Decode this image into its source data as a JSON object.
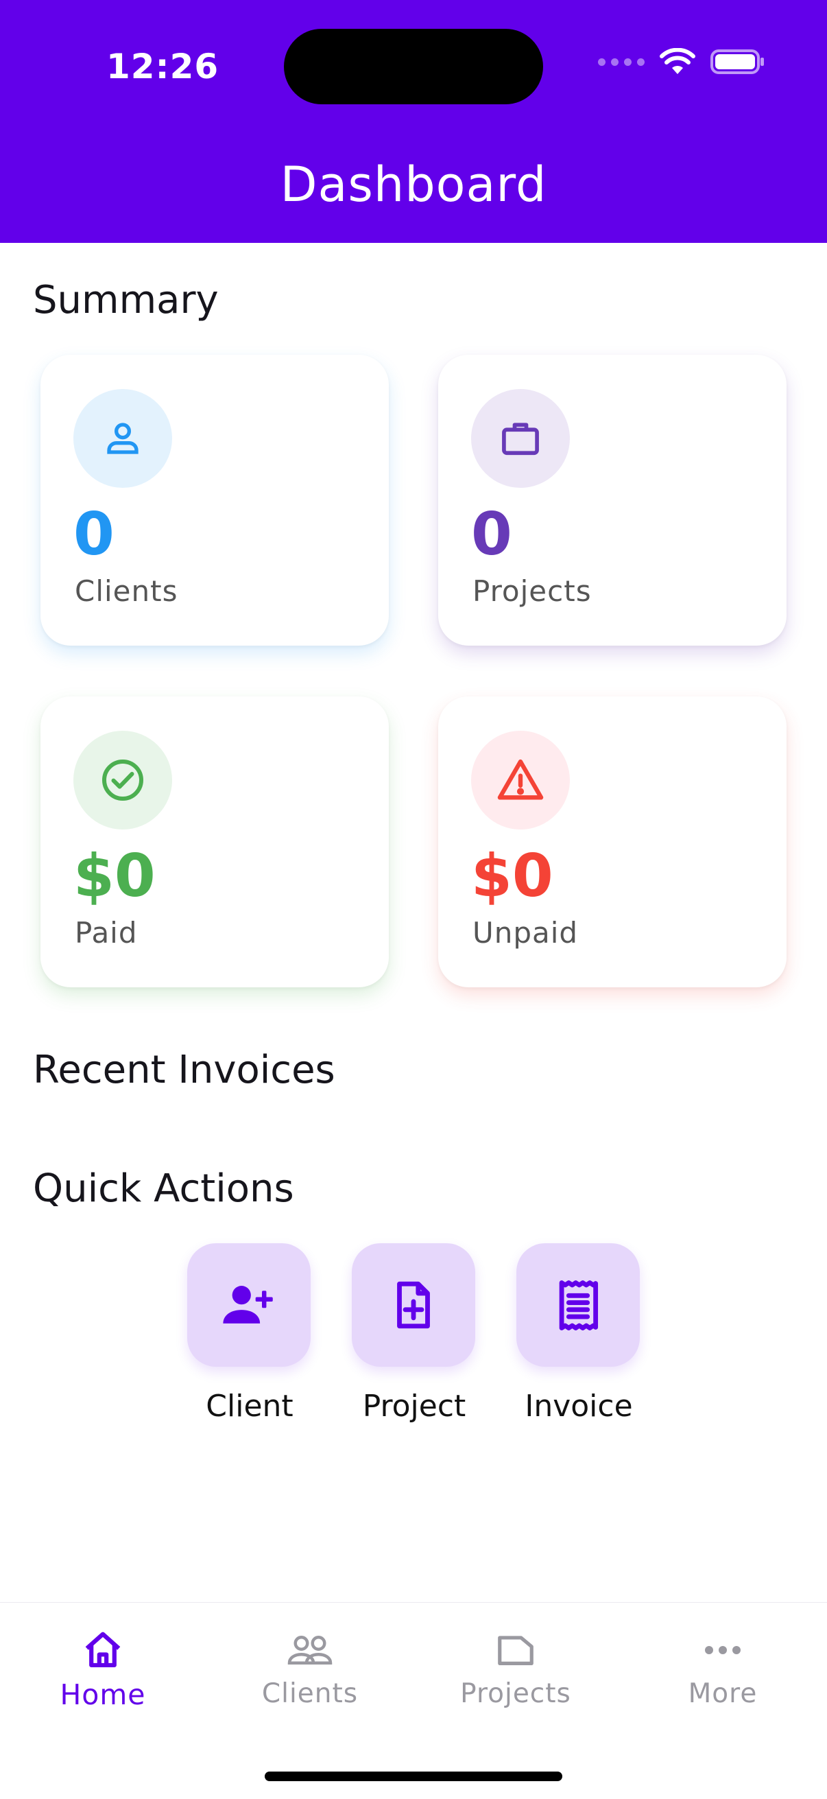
{
  "status_bar": {
    "time": "12:26"
  },
  "header": {
    "title": "Dashboard"
  },
  "summary": {
    "title": "Summary",
    "cards": [
      {
        "value": "0",
        "label": "Clients",
        "icon": "person-icon",
        "color": "#2196f3",
        "bg": "#e3f2fd"
      },
      {
        "value": "0",
        "label": "Projects",
        "icon": "briefcase-icon",
        "color": "#673ab7",
        "bg": "#ede7f6"
      },
      {
        "value": "$0",
        "label": "Paid",
        "icon": "check-circle-icon",
        "color": "#4caf50",
        "bg": "#e8f5e9"
      },
      {
        "value": "$0",
        "label": "Unpaid",
        "icon": "warning-icon",
        "color": "#f44336",
        "bg": "#ffebee"
      }
    ]
  },
  "recent_invoices": {
    "title": "Recent Invoices"
  },
  "quick_actions": {
    "title": "Quick Actions",
    "items": [
      {
        "label": "Client",
        "icon": "add-person-icon"
      },
      {
        "label": "Project",
        "icon": "add-document-icon"
      },
      {
        "label": "Invoice",
        "icon": "receipt-icon"
      }
    ]
  },
  "bottom_nav": {
    "items": [
      {
        "label": "Home",
        "icon": "home-icon",
        "active": true
      },
      {
        "label": "Clients",
        "icon": "people-icon",
        "active": false
      },
      {
        "label": "Projects",
        "icon": "folder-icon",
        "active": false
      },
      {
        "label": "More",
        "icon": "more-horizontal-icon",
        "active": false
      }
    ]
  },
  "colors": {
    "primary": "#6200ea",
    "quick_action_bg": "#e6d7fb"
  }
}
